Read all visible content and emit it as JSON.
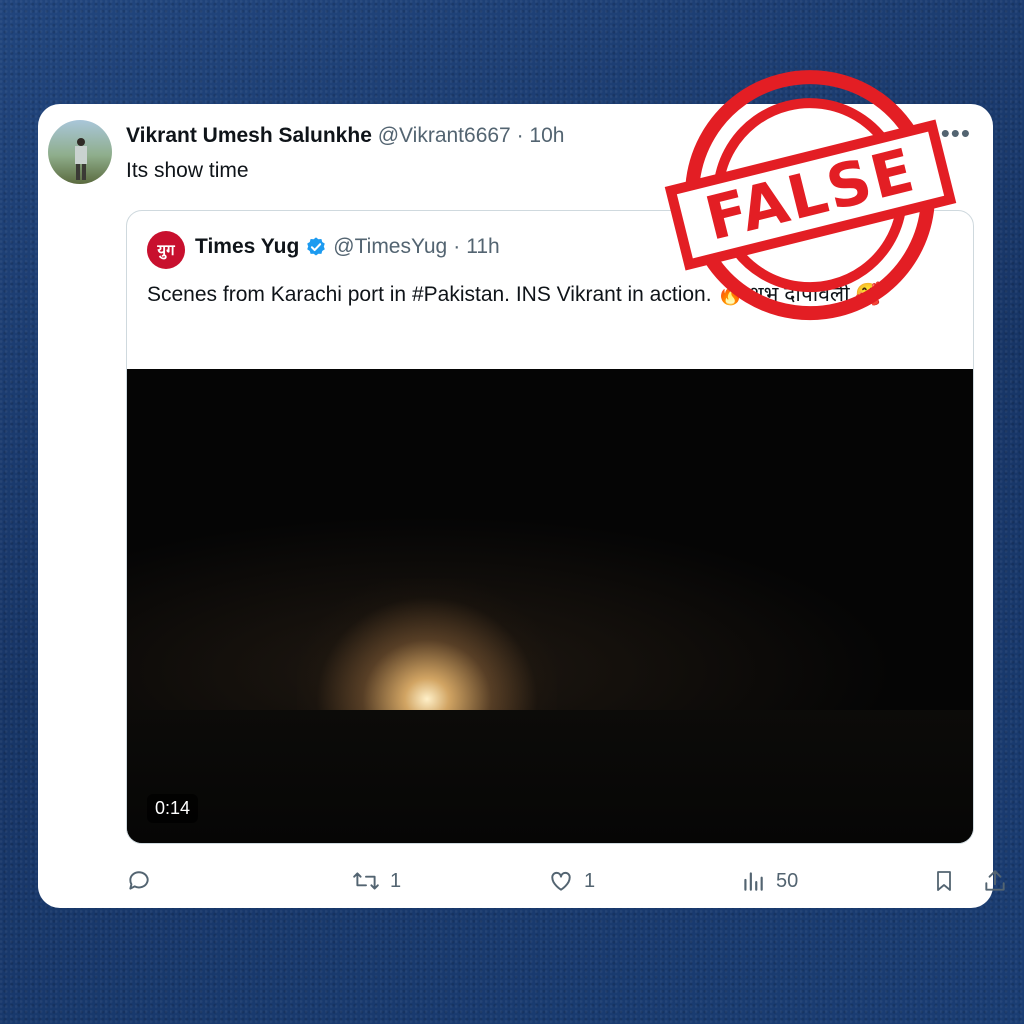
{
  "post": {
    "author_name": "Vikrant Umesh Salunkhe",
    "author_handle": "@Vikrant6667",
    "separator": "·",
    "time": "10h",
    "text": "Its show time"
  },
  "quoted": {
    "logo_text": "युग",
    "name": "Times Yug",
    "handle": "@TimesYug",
    "separator": "·",
    "time": "11h",
    "text": "Scenes from Karachi port in #Pakistan. INS Vikrant in action. 🔥 शुभ दीपावली 🥰",
    "video_duration": "0:14"
  },
  "actions": {
    "reposts": "1",
    "likes": "1",
    "views": "50"
  },
  "stamp": {
    "label": "FALSE",
    "color": "#e31e24"
  }
}
